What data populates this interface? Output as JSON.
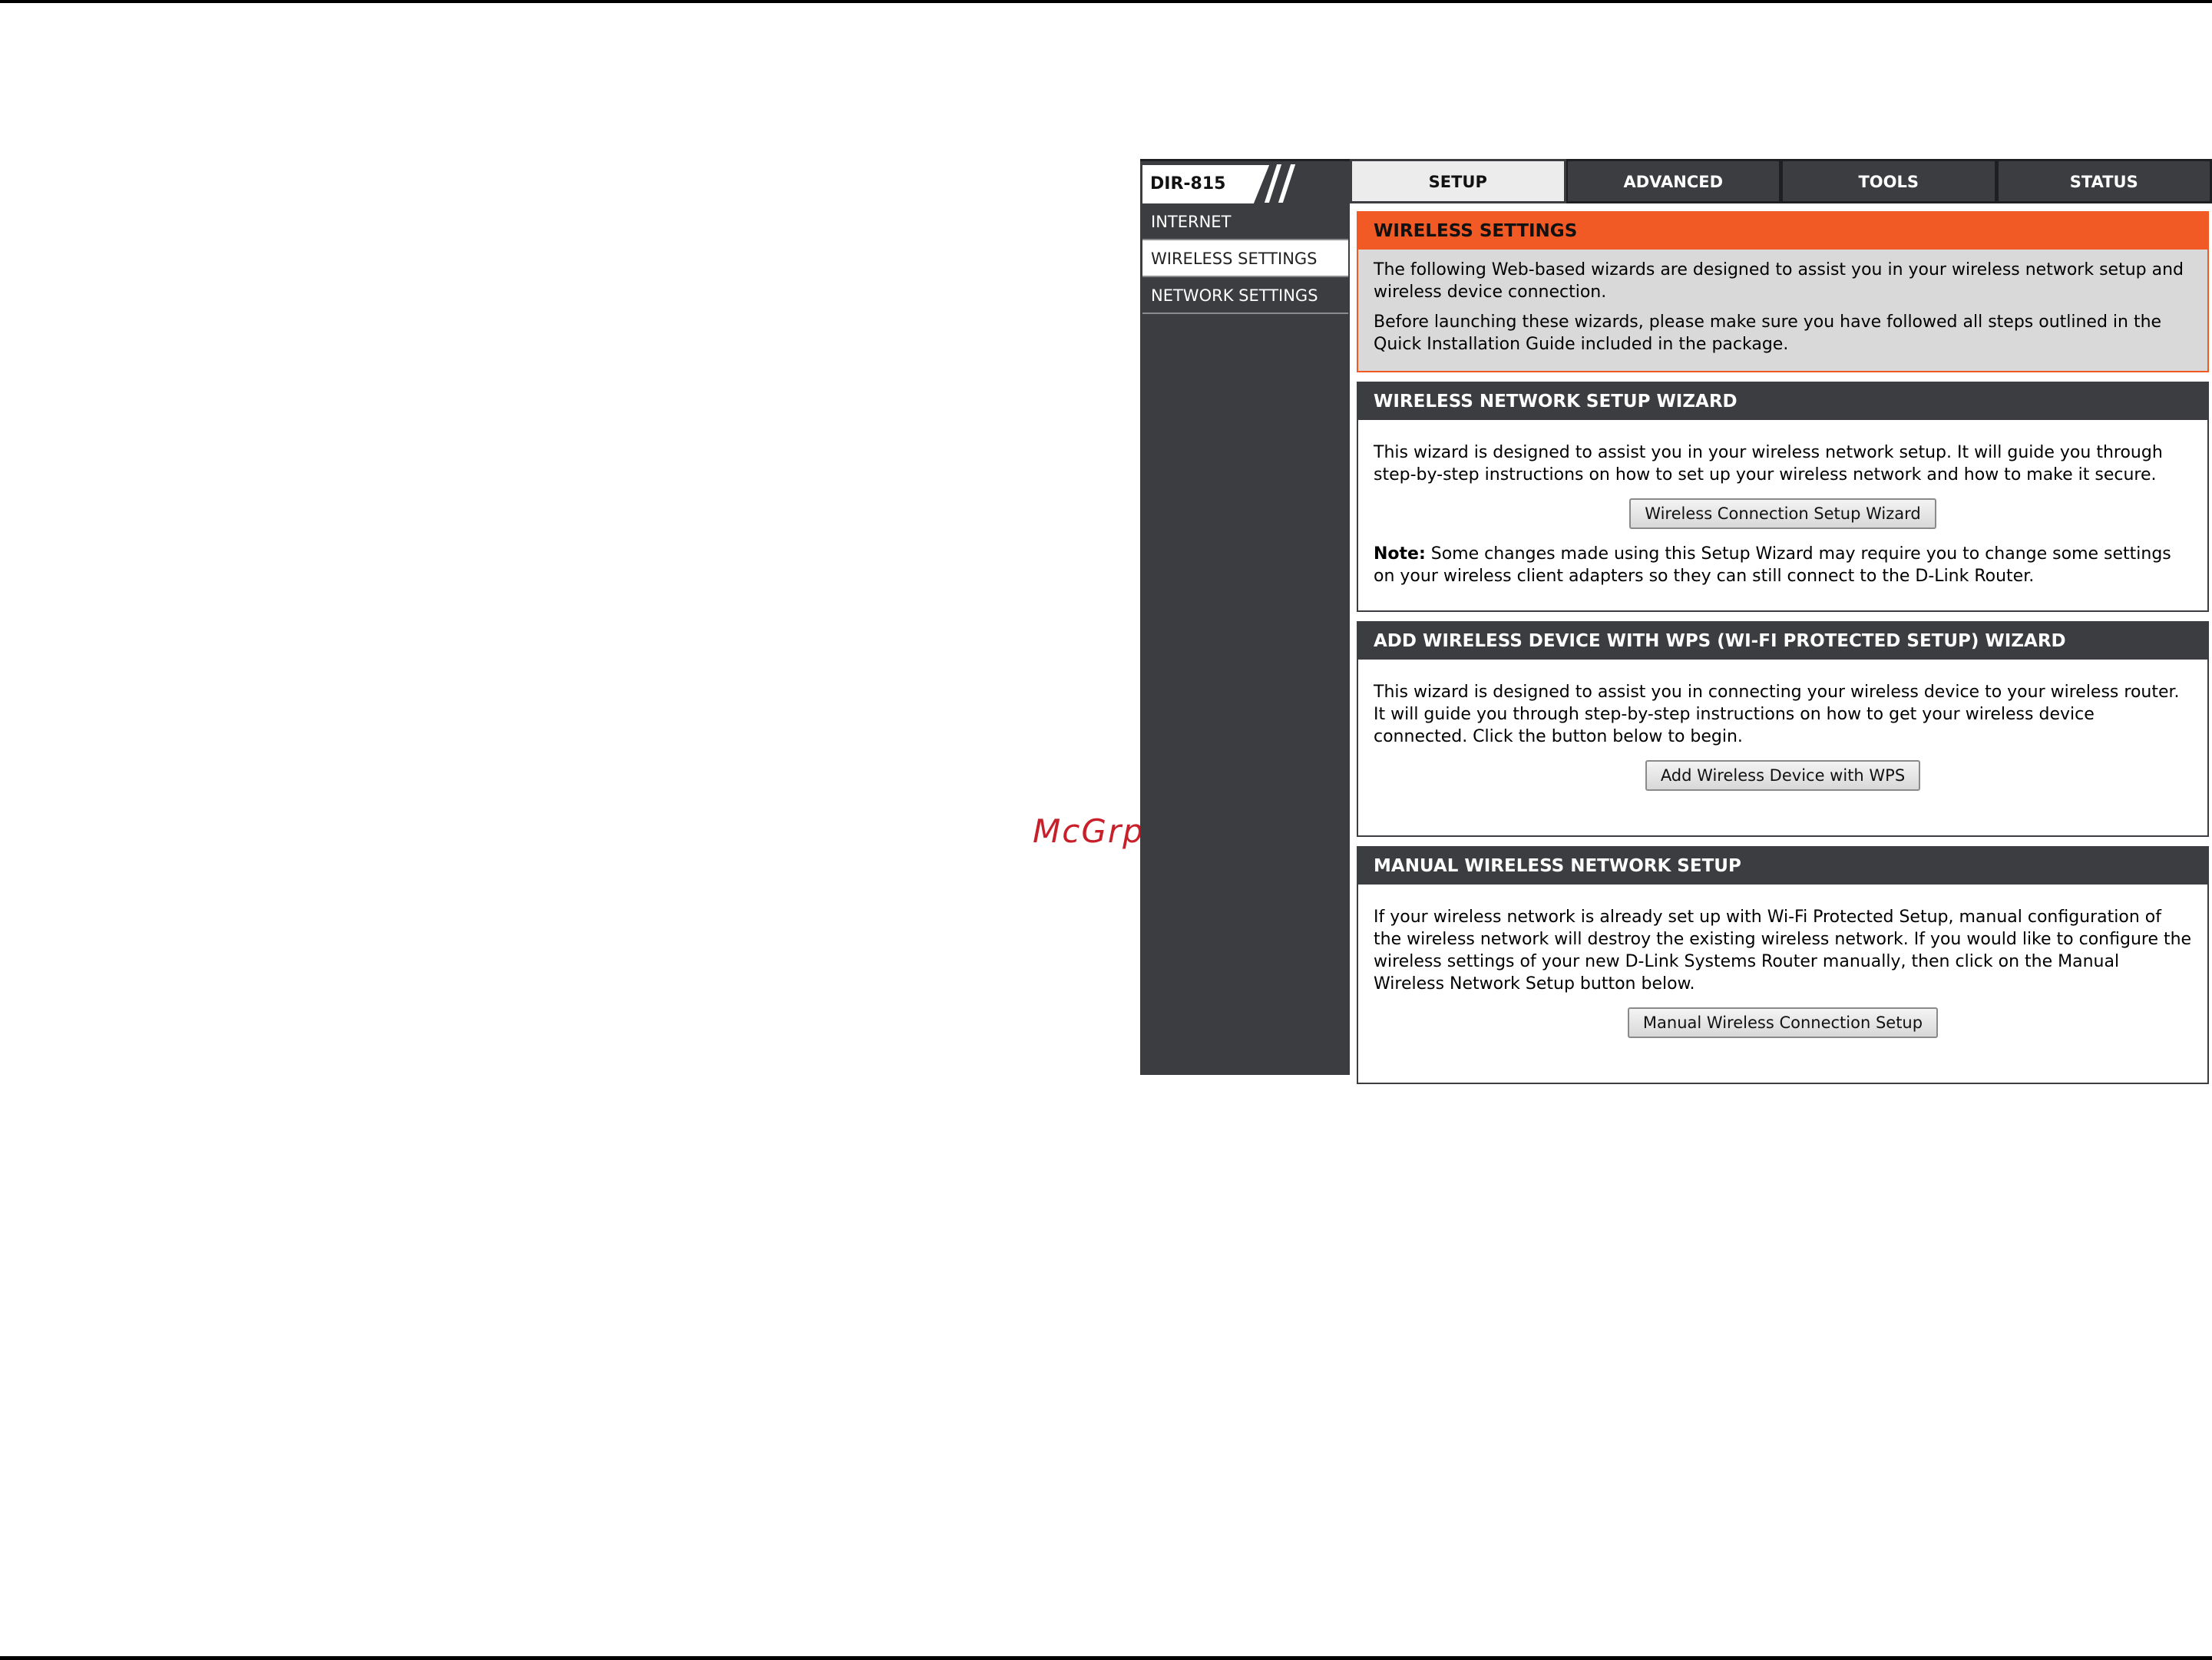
{
  "watermark": "McGrp.Ru",
  "header": {
    "model": "DIR-815"
  },
  "tabs": [
    {
      "label": "SETUP",
      "active": true
    },
    {
      "label": "ADVANCED",
      "active": false
    },
    {
      "label": "TOOLS",
      "active": false
    },
    {
      "label": "STATUS",
      "active": false
    }
  ],
  "sidebar": {
    "items": [
      {
        "label": "INTERNET",
        "active": false
      },
      {
        "label": "WIRELESS SETTINGS",
        "active": true
      },
      {
        "label": "NETWORK SETTINGS",
        "active": false
      }
    ]
  },
  "sections": {
    "intro": {
      "title": "WIRELESS SETTINGS",
      "p1": "The following Web-based wizards are designed to assist you in your wireless network setup and wireless device connection.",
      "p2": "Before launching these wizards, please make sure you have followed all steps outlined in the Quick Installation Guide included in the package."
    },
    "wizard": {
      "title": "WIRELESS NETWORK SETUP WIZARD",
      "p1": "This wizard is designed to assist you in your wireless network setup. It will guide you through step-by-step instructions on how to set up your wireless network and how to make it secure.",
      "button": "Wireless Connection Setup Wizard",
      "note_label": "Note:",
      "note_text": " Some changes made using this Setup Wizard may require you to change some settings on your wireless client adapters so they can still connect to the D-Link Router."
    },
    "wps": {
      "title": "ADD WIRELESS DEVICE WITH WPS (WI-FI PROTECTED SETUP) WIZARD",
      "p1": "This wizard is designed to assist you in connecting your wireless device to your wireless router. It will guide you through step-by-step instructions on how to get your wireless device connected. Click the button below to begin.",
      "button": "Add Wireless Device with WPS"
    },
    "manual": {
      "title": "MANUAL WIRELESS NETWORK SETUP",
      "p1": "If your wireless network is already set up with Wi-Fi Protected Setup, manual configuration of the wireless network will destroy the existing wireless network. If you would like to configure the wireless settings of your new D-Link Systems Router manually, then click on the Manual Wireless Network Setup button below.",
      "button": "Manual Wireless Connection Setup"
    }
  },
  "colors": {
    "accent": "#f15a24",
    "dark": "#3b3d40",
    "panel": "#d9d9d9"
  }
}
